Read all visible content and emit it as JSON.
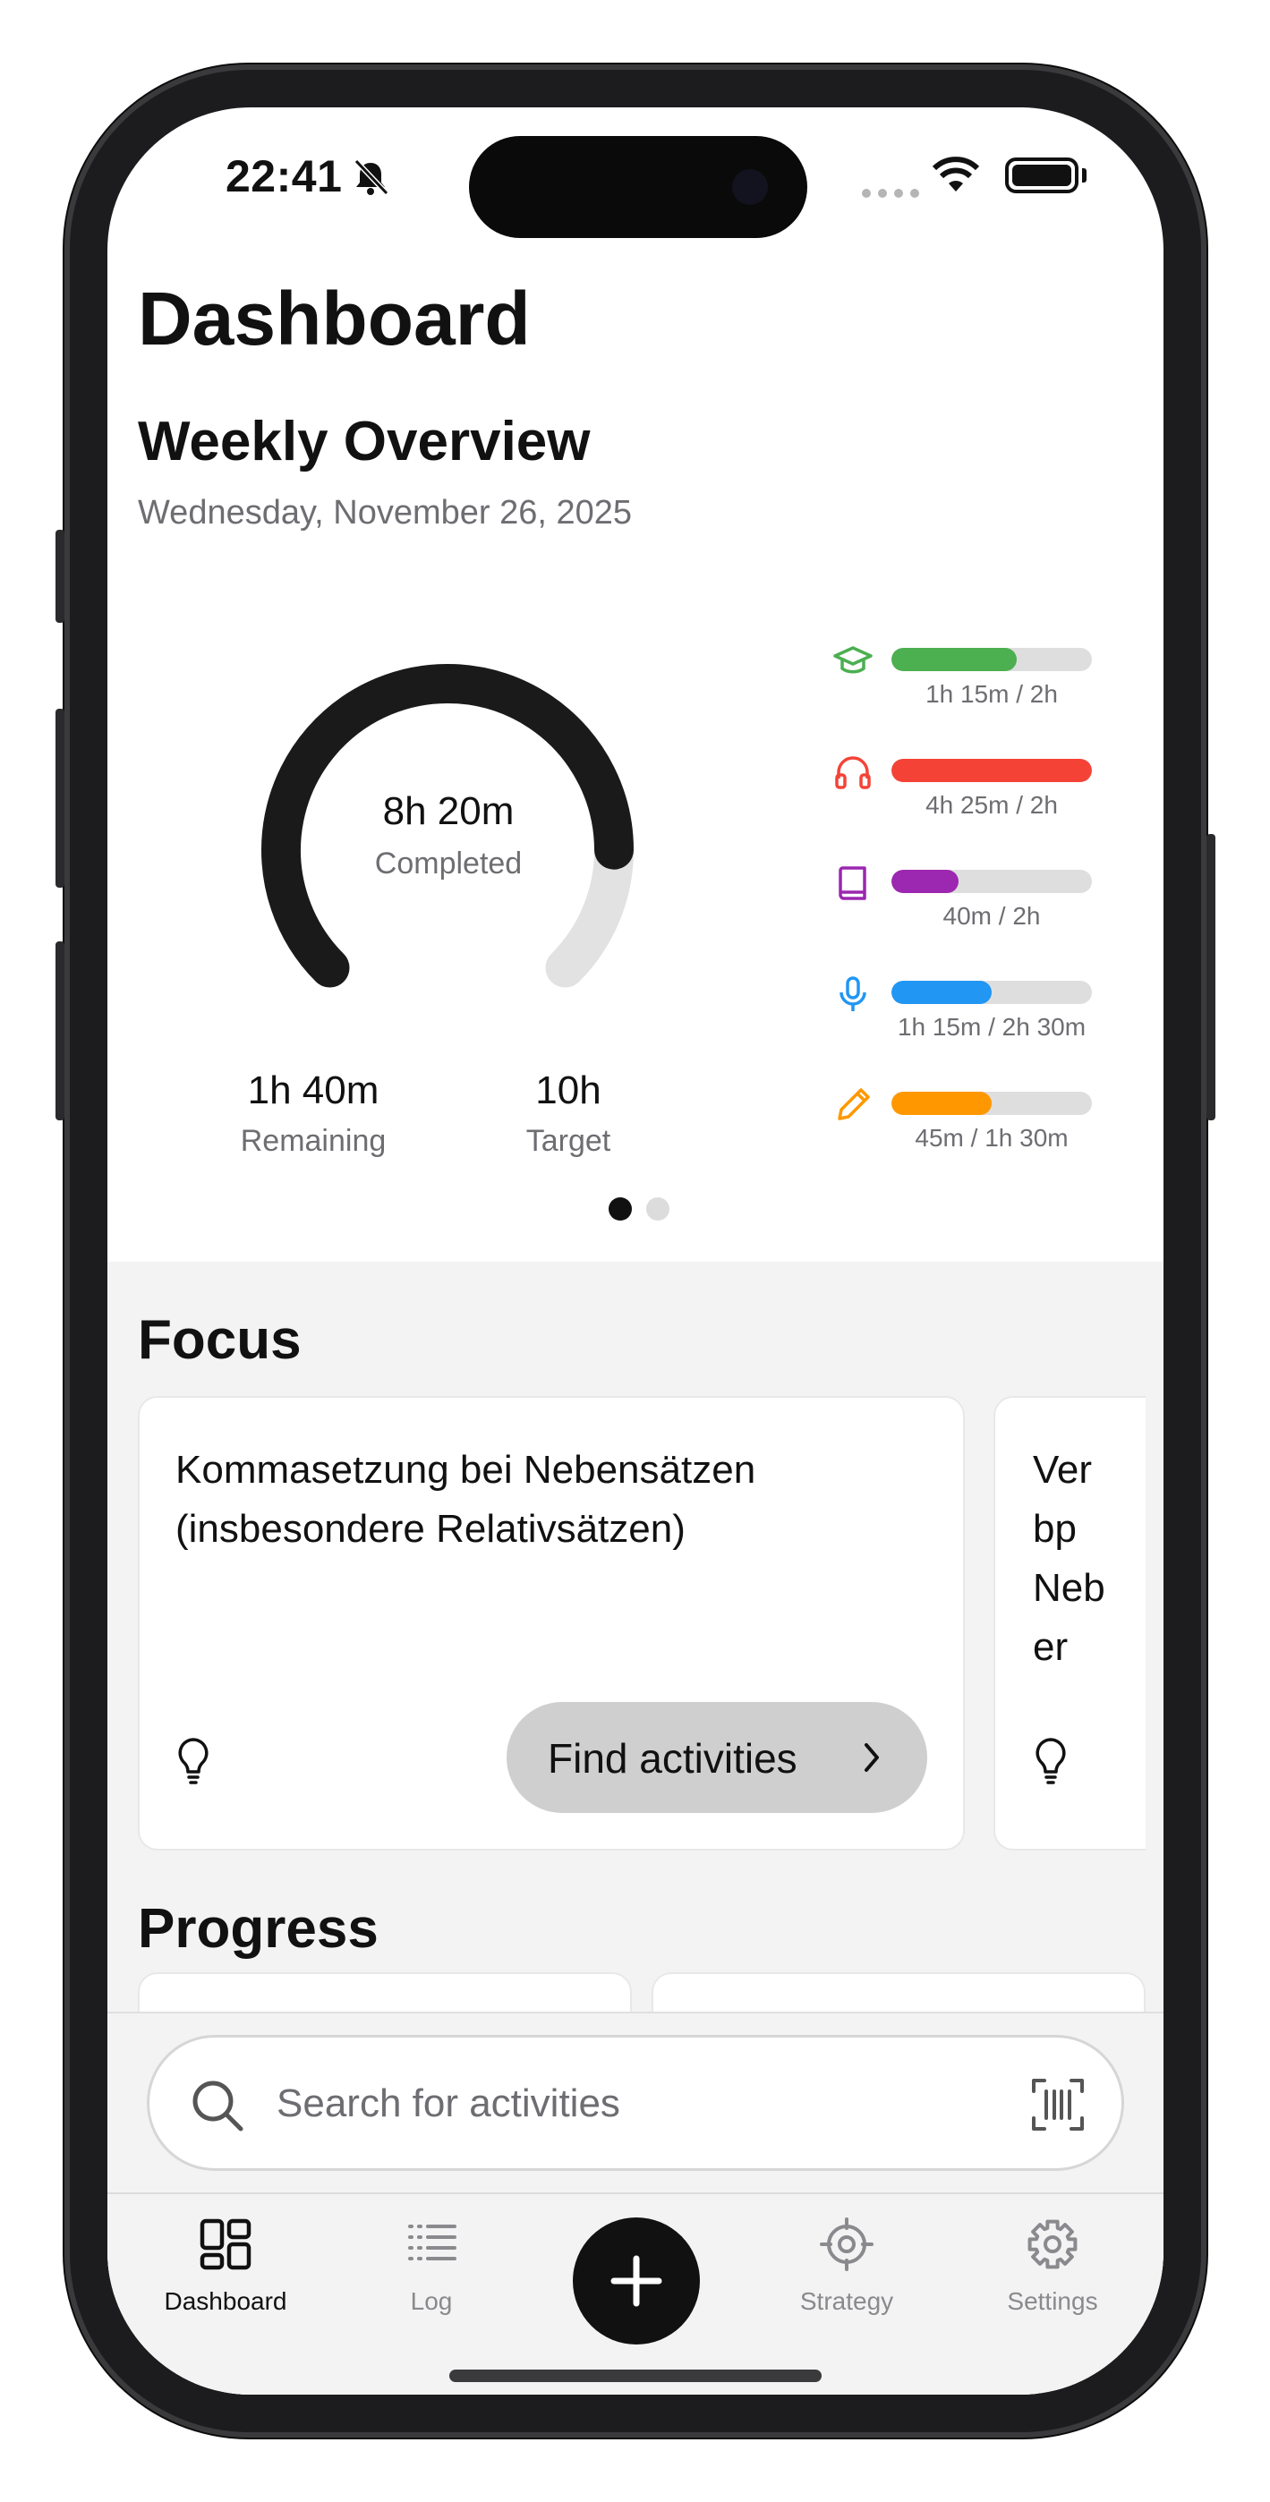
{
  "status_bar": {
    "time": "22:41",
    "icons": [
      "bell-slash-icon",
      "signal-icon",
      "wifi-icon",
      "battery-icon"
    ]
  },
  "header": {
    "title": "Dashboard"
  },
  "weekly_overview": {
    "title": "Weekly Overview",
    "date": "Wednesday, November 26, 2025",
    "gauge": {
      "value": "8h 20m",
      "label": "Completed",
      "progress_fraction": 0.833
    },
    "remaining": {
      "value": "1h 40m",
      "label": "Remaining"
    },
    "target": {
      "value": "10h",
      "label": "Target"
    },
    "categories": [
      {
        "icon": "graduation-cap-icon",
        "color": "#4caf50",
        "fraction": 0.625,
        "text": "1h 15m / 2h"
      },
      {
        "icon": "headphones-icon",
        "color": "#f44336",
        "fraction": 1.0,
        "text": "4h 25m / 2h"
      },
      {
        "icon": "book-icon",
        "color": "#9c27b0",
        "fraction": 0.333,
        "text": "40m / 2h"
      },
      {
        "icon": "microphone-icon",
        "color": "#2196f3",
        "fraction": 0.5,
        "text": "1h 15m / 2h 30m"
      },
      {
        "icon": "pencil-icon",
        "color": "#ff9800",
        "fraction": 0.5,
        "text": "45m / 1h 30m"
      }
    ],
    "pager": {
      "pages": 2,
      "active": 0
    }
  },
  "focus": {
    "title": "Focus",
    "cards": [
      {
        "text": "Kommasetzung bei Nebensätzen (insbesondere Relativsätzen)",
        "button": "Find activities"
      },
      {
        "text": "Verbp Neber"
      }
    ]
  },
  "progress": {
    "title": "Progress"
  },
  "search": {
    "placeholder": "Search for activities"
  },
  "tab_bar": {
    "items": [
      {
        "label": "Dashboard",
        "icon": "grid-icon",
        "active": true
      },
      {
        "label": "Log",
        "icon": "list-icon",
        "active": false
      },
      {
        "label": "Strategy",
        "icon": "target-icon",
        "active": false
      },
      {
        "label": "Settings",
        "icon": "gear-icon",
        "active": false
      }
    ],
    "add_icon": "plus-icon"
  },
  "colors": {
    "accent": "#111111",
    "track": "#dedede",
    "muted_text": "#6d6d72",
    "section_bg": "#f3f3f3"
  }
}
